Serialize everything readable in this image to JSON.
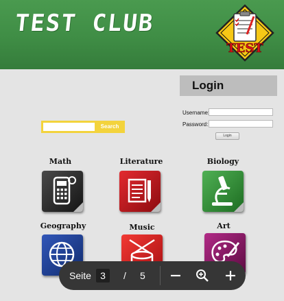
{
  "header": {
    "title": "TEST CLUB",
    "logo_text": "TEST",
    "background": "#3f8d45"
  },
  "login": {
    "title": "Login",
    "username_label": "Username:",
    "password_label": "Password:",
    "button_label": "Login"
  },
  "search": {
    "button_label": "Search",
    "accent": "#f3d33c"
  },
  "subjects": [
    {
      "label": "Math",
      "icon": "calculator-icon",
      "color": "#2b2b2b"
    },
    {
      "label": "Literature",
      "icon": "document-pencil-icon",
      "color": "#c0141b"
    },
    {
      "label": "Biology",
      "icon": "microscope-icon",
      "color": "#2f8f34"
    },
    {
      "label": "Geography",
      "icon": "globe-icon",
      "color": "#1c3f93"
    },
    {
      "label": "Music",
      "icon": "drum-icon",
      "color": "#d41d1d"
    },
    {
      "label": "Art",
      "icon": "palette-icon",
      "color": "#8e1a66"
    }
  ],
  "pdf_toolbar": {
    "page_label": "Seite",
    "current_page": "3",
    "separator": "/",
    "total_pages": "5"
  }
}
